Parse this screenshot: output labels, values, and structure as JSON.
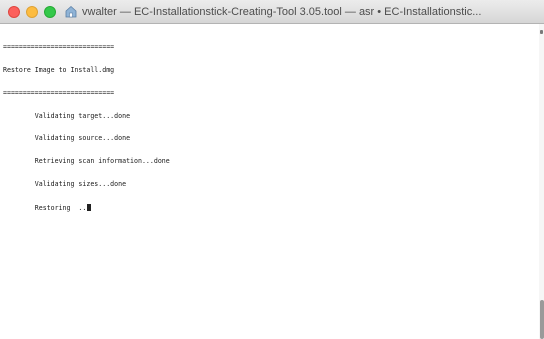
{
  "window": {
    "title": "vwalter — EC-Installationstick-Creating-Tool 3.05.tool — asr • EC-Installationstic...",
    "proxy_icon": "home-folder-icon",
    "controls": [
      "close",
      "minimize",
      "zoom"
    ]
  },
  "terminal": {
    "lines": [
      "============================",
      "Restore Image to Install.dmg",
      "============================",
      "        Validating target...done",
      "        Validating source...done",
      "        Retrieving scan information...done",
      "        Validating sizes...done",
      "        Restoring  .."
    ]
  },
  "colors": {
    "close": "#fc605c",
    "minimize": "#fdbc40",
    "zoom": "#34c84a",
    "text": "#1a1a1a",
    "background": "#ffffff"
  }
}
